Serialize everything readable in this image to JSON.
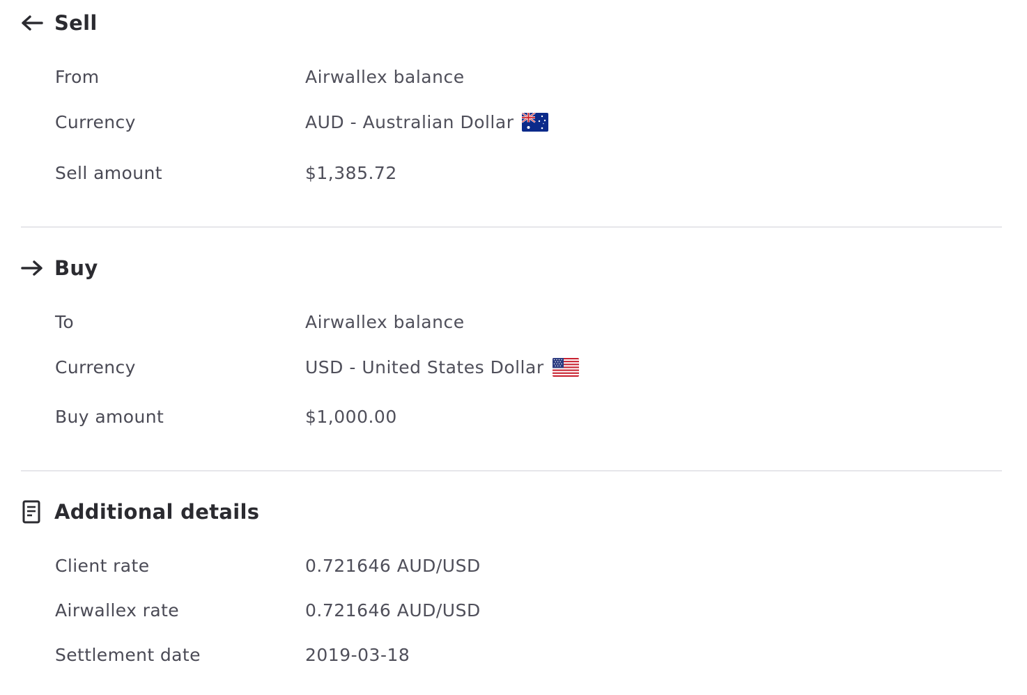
{
  "sell": {
    "title": "Sell",
    "icon": "arrow-left-icon",
    "rows": [
      {
        "label": "From",
        "value": "Airwallex balance"
      },
      {
        "label": "Currency",
        "value": "AUD - Australian Dollar",
        "flag": "australia-flag-icon"
      },
      {
        "label": "Sell amount",
        "value": "$1,385.72"
      }
    ]
  },
  "buy": {
    "title": "Buy",
    "icon": "arrow-right-icon",
    "rows": [
      {
        "label": "To",
        "value": "Airwallex balance"
      },
      {
        "label": "Currency",
        "value": "USD - United States Dollar",
        "flag": "usa-flag-icon"
      },
      {
        "label": "Buy amount",
        "value": "$1,000.00"
      }
    ]
  },
  "additional": {
    "title": "Additional details",
    "icon": "document-icon",
    "rows": [
      {
        "label": "Client rate",
        "value": "0.721646 AUD/USD"
      },
      {
        "label": "Airwallex rate",
        "value": "0.721646 AUD/USD"
      },
      {
        "label": "Settlement date",
        "value": "2019-03-18"
      }
    ]
  },
  "colors": {
    "heading": "#2b2b30",
    "text": "#4a4a55",
    "divider": "#e6e6ea"
  }
}
